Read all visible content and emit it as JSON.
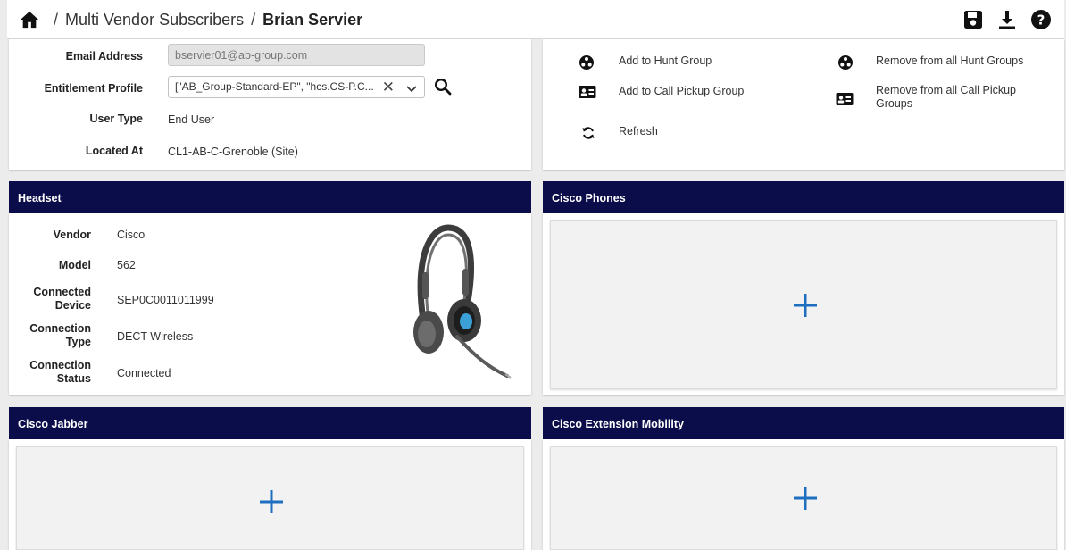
{
  "breadcrumb": {
    "parent": "Multi Vendor Subscribers",
    "current": "Brian Servier"
  },
  "user_form": {
    "email_label": "Email Address",
    "email_value": "bservier01@ab-group.com",
    "entitlement_label": "Entitlement Profile",
    "entitlement_value": "[\"AB_Group-Standard-EP\", \"hcs.CS-P.C...",
    "user_type_label": "User Type",
    "user_type_value": "End User",
    "located_label": "Located At",
    "located_value": "CL1-AB-C-Grenoble (Site)"
  },
  "actions": {
    "add_hunt": "Add to Hunt Group",
    "remove_hunt": "Remove from all Hunt Groups",
    "add_pickup": "Add to Call Pickup Group",
    "remove_pickup": "Remove from all Call Pickup Groups",
    "refresh": "Refresh"
  },
  "headset": {
    "title": "Headset",
    "vendor_label": "Vendor",
    "vendor_value": "Cisco",
    "model_label": "Model",
    "model_value": "562",
    "device_label": "Connected Device",
    "device_value": "SEP0C0011011999",
    "conn_type_label": "Connection Type",
    "conn_type_value": "DECT Wireless",
    "conn_status_label": "Connection Status",
    "conn_status_value": "Connected"
  },
  "panels": {
    "phones": "Cisco Phones",
    "jabber": "Cisco Jabber",
    "mobility": "Cisco Extension Mobility"
  },
  "colors": {
    "header_bg": "#0b0d4a",
    "plus_blue": "#1e6fc0"
  },
  "icons": {
    "home": "home-icon",
    "save": "save-icon",
    "download": "download-icon",
    "help": "help-icon",
    "search": "search-icon",
    "hunt": "hunt-group-icon",
    "pickup": "call-pickup-icon",
    "refresh": "refresh-icon",
    "plus": "plus-icon",
    "clear": "clear-icon",
    "chevron": "chevron-down-icon"
  }
}
